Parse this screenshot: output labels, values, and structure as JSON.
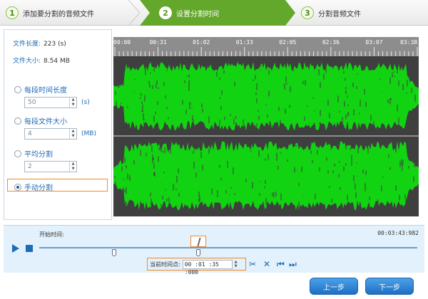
{
  "steps": [
    {
      "num": "1",
      "label": "添加要分割的音频文件"
    },
    {
      "num": "2",
      "label": "设置分割时间"
    },
    {
      "num": "3",
      "label": "分割音频文件"
    }
  ],
  "file_info": {
    "length_label": "文件长度:",
    "length_value": "223 (s)",
    "size_label": "文件大小:",
    "size_value": "8.54 MB"
  },
  "options": {
    "by_time": {
      "label": "每段时间长度",
      "value": "50",
      "unit": "(s)"
    },
    "by_size": {
      "label": "每段文件大小",
      "value": "4",
      "unit": "(MB)"
    },
    "even": {
      "label": "平均分割",
      "value": "2"
    },
    "manual": {
      "label": "手动分割",
      "selected": true
    }
  },
  "ruler_labels": [
    "00:00",
    "00:31",
    "01:02",
    "01:33",
    "02:05",
    "02:36",
    "03:07",
    "03:38"
  ],
  "transport": {
    "start_label": "开始时间:",
    "duration": "00:03:43:982",
    "current_label": "当前时间点:",
    "current_value": "00 :01 :35 :000",
    "playhead_fraction": 0.426
  },
  "buttons": {
    "prev": "上一步",
    "next": "下一步"
  },
  "colors": {
    "wave": "#11d311",
    "wave_bg": "#3f3f3f",
    "accent": "#1e6bb8",
    "highlight": "#f08a2c",
    "step_active": "#63a82b"
  }
}
